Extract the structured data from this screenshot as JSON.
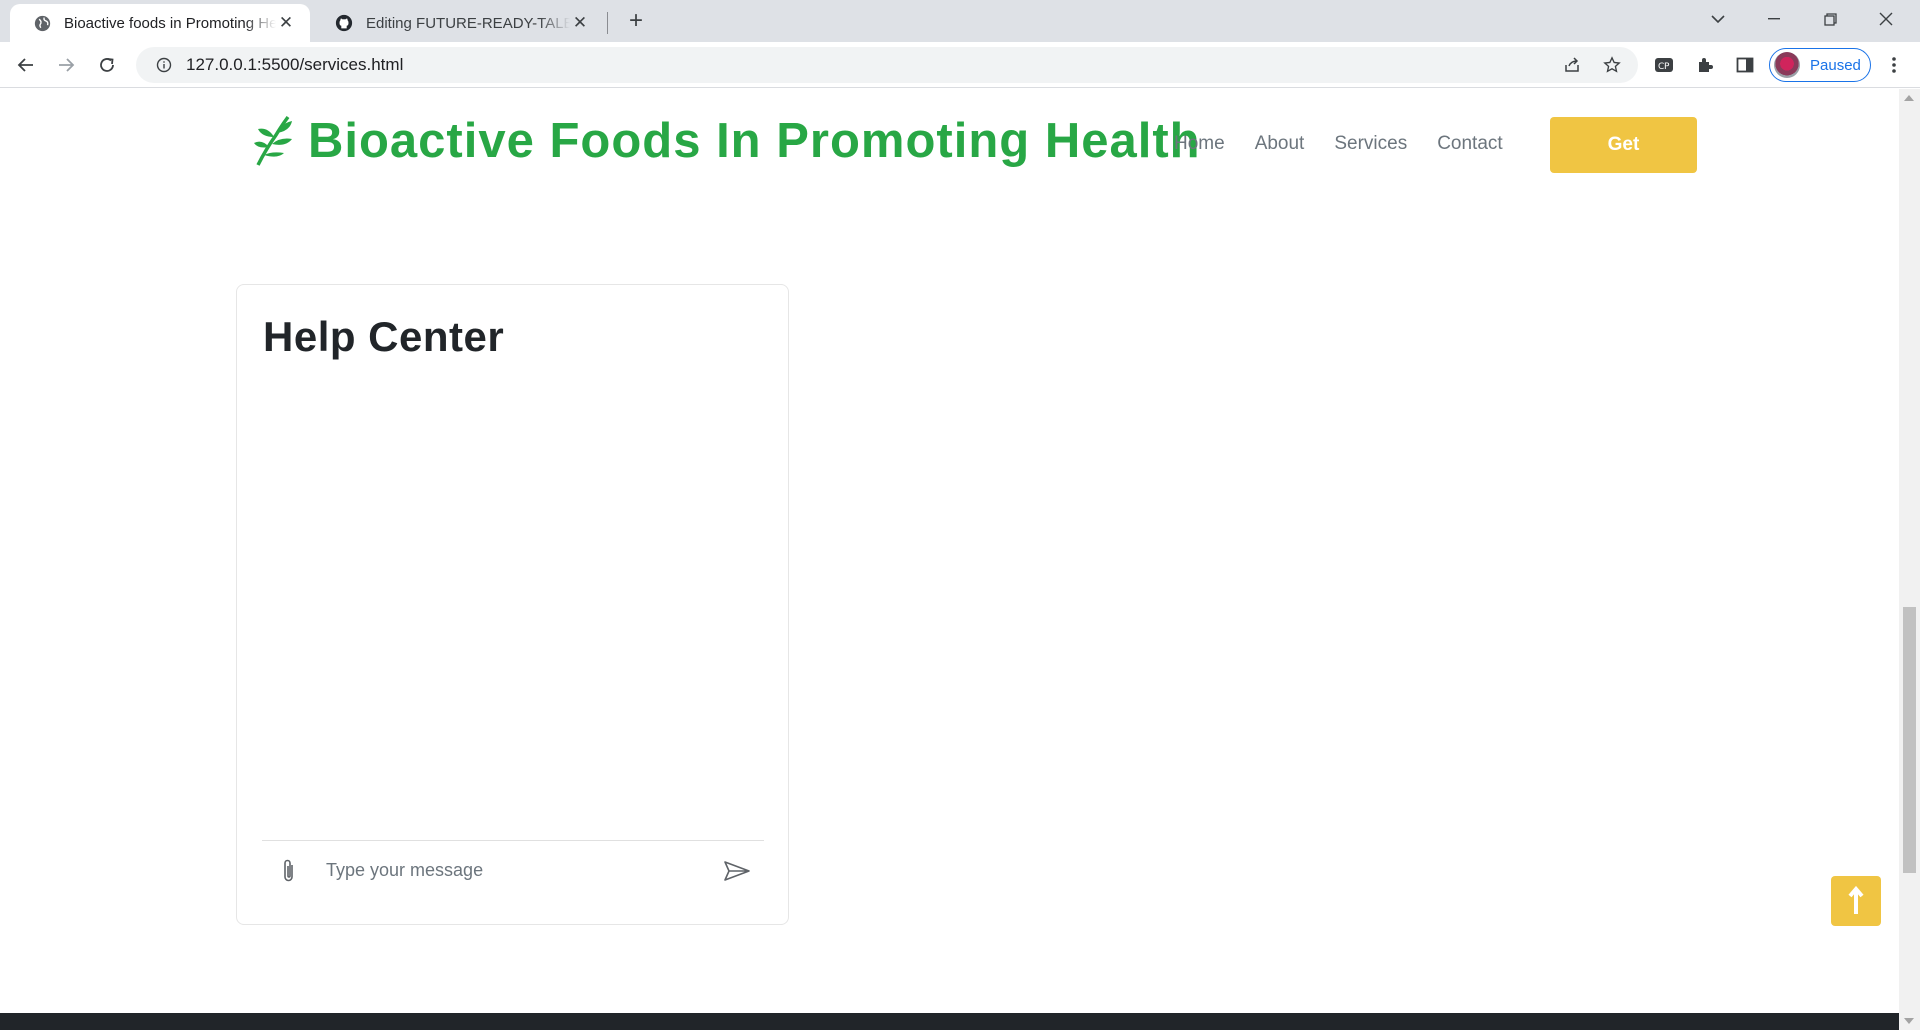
{
  "browser": {
    "tabs": [
      {
        "title": "Bioactive foods in Promoting Health",
        "close": "✕"
      },
      {
        "title": "Editing FUTURE-READY-TALENT-INTERNSHIP",
        "close": "✕"
      }
    ],
    "new_tab": "+",
    "url": "127.0.0.1:5500/services.html",
    "profile_status": "Paused"
  },
  "navbar": {
    "brand": "Bioactive Foods In Promoting Health",
    "links": [
      "Home",
      "About",
      "Services",
      "Contact"
    ],
    "cta": "Get"
  },
  "help_center": {
    "title": "Help Center",
    "message_placeholder": "Type your message"
  },
  "colors": {
    "brand_green": "#28a745",
    "accent_yellow": "#f0c543",
    "footer_dark": "#212529"
  },
  "icons": {
    "attach": "paperclip-icon",
    "send": "send-icon",
    "back_to_top": "arrow-up-icon"
  }
}
